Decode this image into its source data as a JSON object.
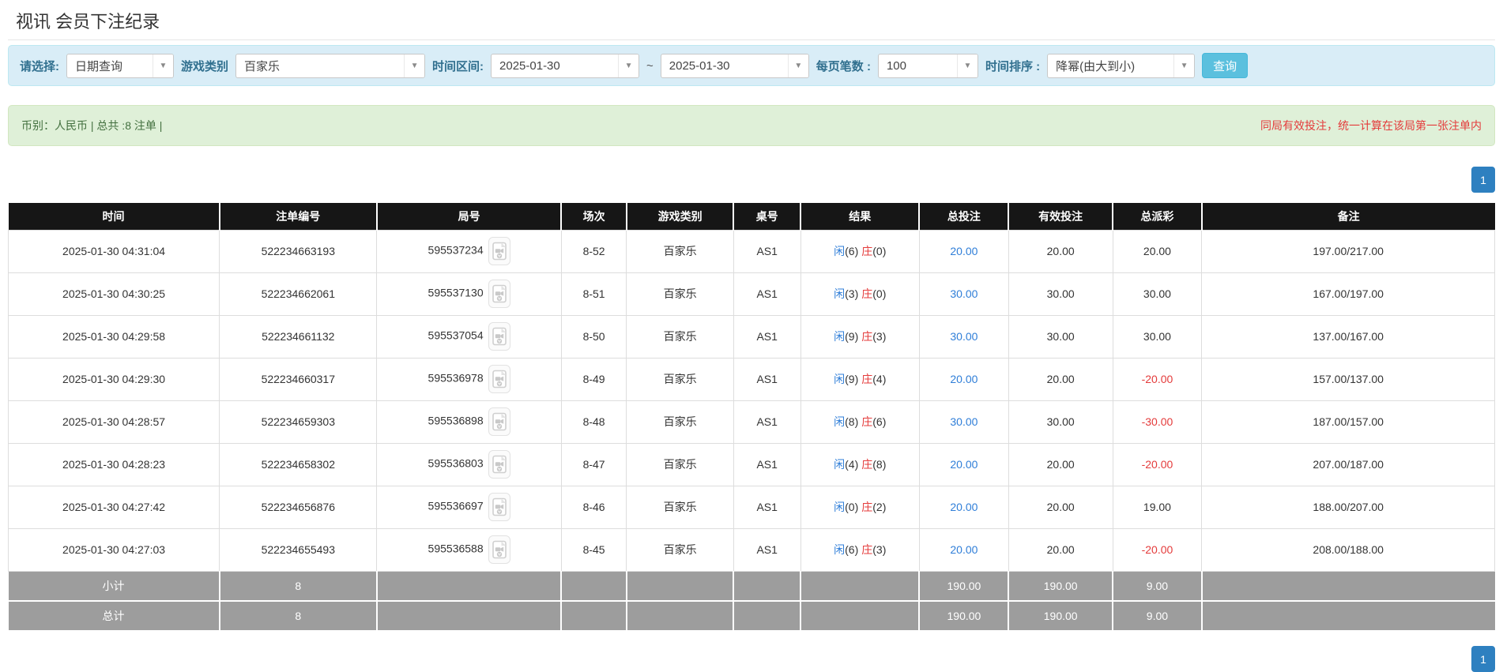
{
  "page": {
    "title": "视讯 会员下注纪录"
  },
  "filters": {
    "mode_label": "请选择:",
    "mode_value": "日期查询",
    "game_type_label": "游戏类别",
    "game_type_value": "百家乐",
    "time_range_label": "时间区间:",
    "date_from": "2025-01-30",
    "date_separator": "~",
    "date_to": "2025-01-30",
    "page_size_label": "每页笔数 :",
    "page_size_value": "100",
    "sort_label": "时间排序 :",
    "sort_value": "降幂(由大到小)",
    "search_button": "查询"
  },
  "summary": {
    "left": "币别：人民币 | 总共 :8 注单 |",
    "right": "同局有效投注，统一计算在该局第一张注单内"
  },
  "pagination": {
    "current": "1"
  },
  "colors": {
    "link_blue": "#2f7ed8",
    "negative_red": "#e43b3b",
    "player_blue": "#2f7ed8",
    "banker_red": "#e43b3b",
    "search_button_cyan": "#5bc0de",
    "pagination_blue": "#2e80c0",
    "header_bg": "#161616",
    "footer_gray": "#9d9d9d",
    "filter_panel_bg": "#d9edf7",
    "summary_bar_bg": "#dff0d8"
  },
  "table": {
    "headers": [
      "时间",
      "注单编号",
      "局号",
      "场次",
      "游戏类别",
      "桌号",
      "结果",
      "总投注",
      "有效投注",
      "总派彩",
      "备注"
    ],
    "rows": [
      {
        "time": "2025-01-30 04:31:04",
        "bet_id": "522234663193",
        "round_id": "595537234",
        "session": "8-52",
        "game": "百家乐",
        "table": "AS1",
        "result_player": "闲",
        "result_player_n": "(6)",
        "result_banker": "庄",
        "result_banker_n": "(0)",
        "total_bet": "20.00",
        "valid_bet": "20.00",
        "payout": "20.00",
        "payout_negative": false,
        "remark": "197.00/217.00"
      },
      {
        "time": "2025-01-30 04:30:25",
        "bet_id": "522234662061",
        "round_id": "595537130",
        "session": "8-51",
        "game": "百家乐",
        "table": "AS1",
        "result_player": "闲",
        "result_player_n": "(3)",
        "result_banker": "庄",
        "result_banker_n": "(0)",
        "total_bet": "30.00",
        "valid_bet": "30.00",
        "payout": "30.00",
        "payout_negative": false,
        "remark": "167.00/197.00"
      },
      {
        "time": "2025-01-30 04:29:58",
        "bet_id": "522234661132",
        "round_id": "595537054",
        "session": "8-50",
        "game": "百家乐",
        "table": "AS1",
        "result_player": "闲",
        "result_player_n": "(9)",
        "result_banker": "庄",
        "result_banker_n": "(3)",
        "total_bet": "30.00",
        "valid_bet": "30.00",
        "payout": "30.00",
        "payout_negative": false,
        "remark": "137.00/167.00"
      },
      {
        "time": "2025-01-30 04:29:30",
        "bet_id": "522234660317",
        "round_id": "595536978",
        "session": "8-49",
        "game": "百家乐",
        "table": "AS1",
        "result_player": "闲",
        "result_player_n": "(9)",
        "result_banker": "庄",
        "result_banker_n": "(4)",
        "total_bet": "20.00",
        "valid_bet": "20.00",
        "payout": "-20.00",
        "payout_negative": true,
        "remark": "157.00/137.00"
      },
      {
        "time": "2025-01-30 04:28:57",
        "bet_id": "522234659303",
        "round_id": "595536898",
        "session": "8-48",
        "game": "百家乐",
        "table": "AS1",
        "result_player": "闲",
        "result_player_n": "(8)",
        "result_banker": "庄",
        "result_banker_n": "(6)",
        "total_bet": "30.00",
        "valid_bet": "30.00",
        "payout": "-30.00",
        "payout_negative": true,
        "remark": "187.00/157.00"
      },
      {
        "time": "2025-01-30 04:28:23",
        "bet_id": "522234658302",
        "round_id": "595536803",
        "session": "8-47",
        "game": "百家乐",
        "table": "AS1",
        "result_player": "闲",
        "result_player_n": "(4)",
        "result_banker": "庄",
        "result_banker_n": "(8)",
        "total_bet": "20.00",
        "valid_bet": "20.00",
        "payout": "-20.00",
        "payout_negative": true,
        "remark": "207.00/187.00"
      },
      {
        "time": "2025-01-30 04:27:42",
        "bet_id": "522234656876",
        "round_id": "595536697",
        "session": "8-46",
        "game": "百家乐",
        "table": "AS1",
        "result_player": "闲",
        "result_player_n": "(0)",
        "result_banker": "庄",
        "result_banker_n": "(2)",
        "total_bet": "20.00",
        "valid_bet": "20.00",
        "payout": "19.00",
        "payout_negative": false,
        "remark": "188.00/207.00"
      },
      {
        "time": "2025-01-30 04:27:03",
        "bet_id": "522234655493",
        "round_id": "595536588",
        "session": "8-45",
        "game": "百家乐",
        "table": "AS1",
        "result_player": "闲",
        "result_player_n": "(6)",
        "result_banker": "庄",
        "result_banker_n": "(3)",
        "total_bet": "20.00",
        "valid_bet": "20.00",
        "payout": "-20.00",
        "payout_negative": true,
        "remark": "208.00/188.00"
      }
    ],
    "subtotal": {
      "label": "小计",
      "count": "8",
      "total_bet": "190.00",
      "valid_bet": "190.00",
      "payout": "9.00"
    },
    "total": {
      "label": "总计",
      "count": "8",
      "total_bet": "190.00",
      "valid_bet": "190.00",
      "payout": "9.00"
    }
  }
}
